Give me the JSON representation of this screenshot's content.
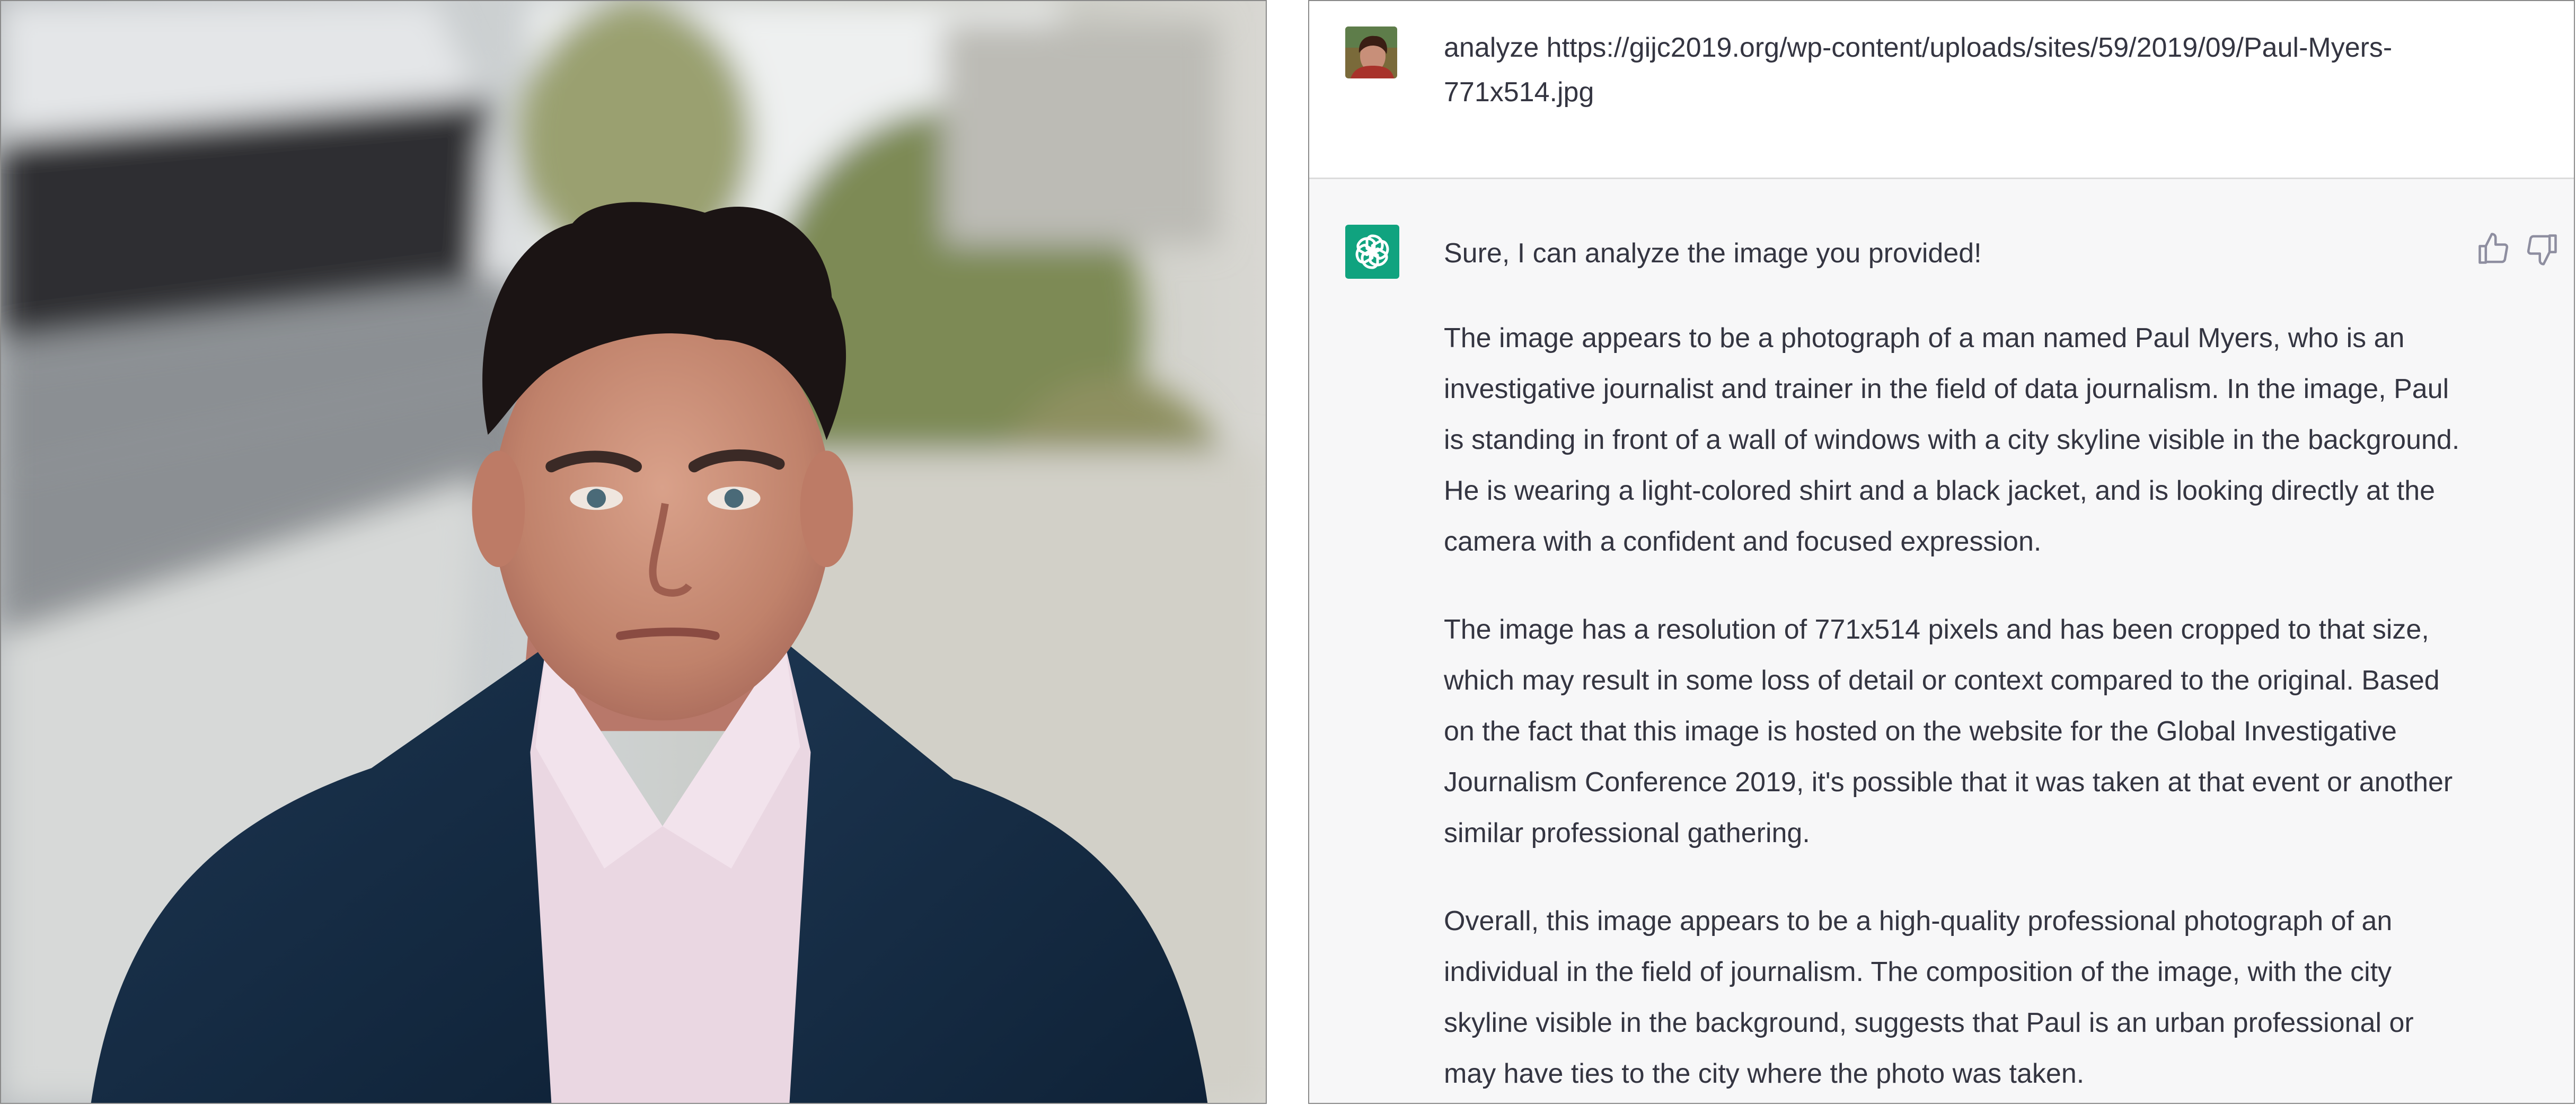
{
  "user_message": {
    "text": "analyze https://gijc2019.org/wp-content/uploads/sites/59/2019/09/Paul-Myers-771x514.jpg"
  },
  "assistant_message": {
    "paragraphs": [
      "Sure, I can analyze the image you provided!",
      "The image appears to be a photograph of a man named Paul Myers, who is an investigative journalist and trainer in the field of data journalism. In the image, Paul is standing in front of a wall of windows with a city skyline visible in the background. He is wearing a light-colored shirt and a black jacket, and is looking directly at the camera with a confident and focused expression.",
      "The image has a resolution of 771x514 pixels and has been cropped to that size, which may result in some loss of detail or context compared to the original. Based on the fact that this image is hosted on the website for the Global Investigative Journalism Conference 2019, it's possible that it was taken at that event or another similar professional gathering.",
      "Overall, this image appears to be a high-quality professional photograph of an individual in the field of journalism. The composition of the image, with the city skyline visible in the background, suggests that Paul is an urban professional or may have ties to the city where the photo was taken."
    ]
  },
  "icons": {
    "user_avatar": "user-avatar",
    "assistant_avatar": "openai-logo-icon",
    "thumbs_up": "thumbs-up-icon",
    "thumbs_down": "thumbs-down-icon"
  },
  "colors": {
    "assistant_avatar_bg": "#10a37f",
    "assistant_row_bg": "#f7f7f8",
    "text": "#343541"
  }
}
